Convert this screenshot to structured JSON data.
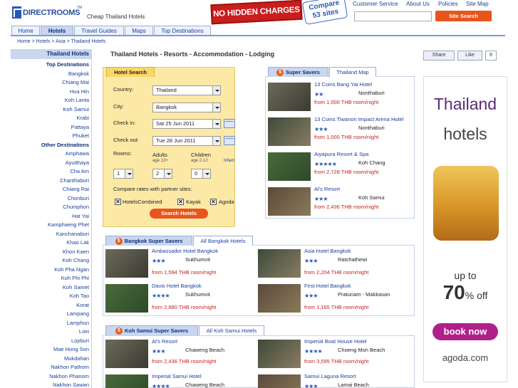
{
  "header": {
    "logo_text": "DIRECTROOMS",
    "logo_tm": "TM",
    "tagline": "Cheap Thailand Hotels",
    "banner_text": "NO HIDDEN CHARGES",
    "compare_line1": "Compare",
    "compare_line2": "53 sites",
    "links": [
      "Customer Service",
      "About Us",
      "Policies",
      "Site Map"
    ],
    "site_search_label": "Site Search"
  },
  "nav": {
    "tabs": [
      "Home",
      "Hotels",
      "Travel Guides",
      "Maps",
      "Top Destinations"
    ]
  },
  "breadcrumb": "Home > Hotels > Asia > Thailand Hotels",
  "sidebar": {
    "title": "Thailand Hotels",
    "top_head": "Top Destinations",
    "top": [
      "Bangkok",
      "Chiang Mai",
      "Hua Hin",
      "Koh Lanta",
      "Koh Samui",
      "Krabi",
      "Pattaya",
      "Phuket"
    ],
    "other_head": "Other Destinations",
    "other": [
      "Amphawa",
      "Ayutthaya",
      "Cha Am",
      "Chanthaburi",
      "Chiang Rai",
      "Chonburi",
      "Chumphon",
      "Hat Yai",
      "Kamphaeng Phet",
      "Kanchanaburi",
      "Khao Lak",
      "Khon Kaen",
      "Koh Chang",
      "Koh Pha Ngan",
      "Koh Phi Phi",
      "Koh Samet",
      "Koh Tao",
      "Korat",
      "Lampang",
      "Lamphun",
      "Loei",
      "Lopburi",
      "Mae Hong Son",
      "Mukdahan",
      "Nakhon Pathom",
      "Nakhon Phanom",
      "Nakhon Sawan"
    ]
  },
  "page_title": "Thailand Hotels - Resorts - Accommodation - Lodging",
  "social": {
    "share": "Share",
    "like": "Like",
    "count": "9"
  },
  "search": {
    "tab": "Hotel Search",
    "country_label": "Country:",
    "country": "Thailand",
    "city_label": "City:",
    "city": "Bangkok",
    "checkin_label": "Check in:",
    "checkin": "Sat 25 Jun 2011",
    "checkout_label": "Check out:",
    "checkout": "Tue 28 Jun 2011",
    "rooms_label": "Rooms:",
    "adults_label": "Adults",
    "adults_sub": "age 13+",
    "children_label": "Children",
    "children_sub": "age 2-12",
    "infant_label": "Infant",
    "rooms": "1",
    "adults": "2",
    "children": "0",
    "compare_label": "Compare rates with partner sites:",
    "partners": [
      "HotelsCombined",
      "Kayak",
      "Agoda"
    ],
    "button": "Search Hotels"
  },
  "super_savers": {
    "tab": "Super Savers",
    "tab2": "Thailand Map",
    "hotels": [
      {
        "name": "13 Coins Bang Yai Hotel",
        "stars": "★★",
        "area": "Nonthaburi",
        "price": "from 1,000 THB room/night"
      },
      {
        "name": "13 Coins Tiwanon Impact Arena Hotel",
        "stars": "★★★",
        "area": "Nonthaburi",
        "price": "from 1,000 THB room/night"
      },
      {
        "name": "Aiyapura Resort & Spa",
        "stars": "★★★★★",
        "area": "Koh Chang",
        "price": "from 2,728 THB room/night"
      },
      {
        "name": "Al's Resort",
        "stars": "★★★",
        "area": "Koh Samui",
        "price": "from 2,436 THB room/night"
      }
    ]
  },
  "bangkok": {
    "tab": "Bangkok Super Savers",
    "tab2": "All Bangkok Hotels",
    "hotels": [
      {
        "name": "Ambassador Hotel Bangkok",
        "stars": "★★★",
        "area": "Sukhumvit",
        "price": "from 1,594 THB room/night"
      },
      {
        "name": "Asia Hotel Bangkok",
        "stars": "★★★",
        "area": "Ratchathewi",
        "price": "from 2,204 THB room/night"
      },
      {
        "name": "Davis Hotel Bangkok",
        "stars": "★★★★",
        "area": "Sukhumvit",
        "price": "from 2,680 THB room/night"
      },
      {
        "name": "First Hotel Bangkok",
        "stars": "★★★",
        "area": "Pratunam - Makkasan",
        "price": "from 1,165 THB room/night"
      }
    ]
  },
  "samui": {
    "tab": "Koh Samui Super Savers",
    "tab2": "All Koh Samui Hotels",
    "hotels": [
      {
        "name": "Al's Resort",
        "stars": "★★★",
        "area": "Chaweng Beach",
        "price": "from 2,436 THB room/night"
      },
      {
        "name": "Imperial Boat House Hotel",
        "stars": "★★★★",
        "area": "Choeng Mon Beach",
        "price": "from 3,595 THB room/night"
      },
      {
        "name": "Imperial Samui Hotel",
        "stars": "★★★★",
        "area": "Chaweng Beach",
        "price": ""
      },
      {
        "name": "Samui Laguna Resort",
        "stars": "★★★",
        "area": "Lamai Beach",
        "price": ""
      }
    ]
  },
  "ad": {
    "title": "Thailand",
    "subtitle": "hotels",
    "upto": "up to",
    "pct": "70",
    "pct_suffix": "% off",
    "button": "book now",
    "brand": "agoda.com"
  },
  "colors": {
    "accent": "#e8551c",
    "link": "#1b3f9c",
    "tab": "#c9d6ef",
    "search_bg": "#fde9a6"
  }
}
